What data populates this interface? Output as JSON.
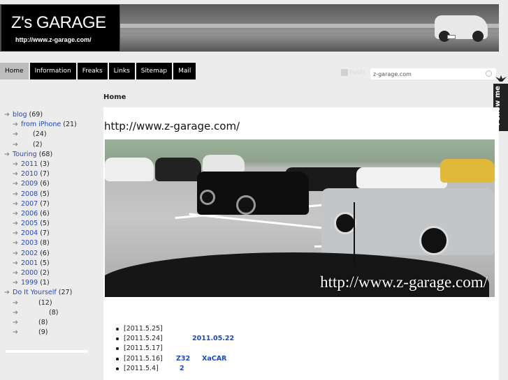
{
  "banner": {
    "title": "Z's GARAGE",
    "url": "http://www.z-garage.com/"
  },
  "nav": {
    "items": [
      "Home",
      "Information",
      "Freaks",
      "Links",
      "Sitemap",
      "Mail"
    ]
  },
  "search": {
    "rss_label": "Posts",
    "value": "z-garage.com"
  },
  "follow": {
    "label": "Follow me"
  },
  "breadcrumb": "Home",
  "main": {
    "site_url": "http://www.z-garage.com/",
    "hero_caption": "http://www.z-garage.com/"
  },
  "sidebar": {
    "blog": {
      "label": "blog",
      "count": "(69)"
    },
    "blog_children": [
      {
        "label": "from iPhone",
        "count": "(21)"
      },
      {
        "label": "",
        "count": "(24)"
      },
      {
        "label": "",
        "count": "(2)"
      }
    ],
    "touring": {
      "label": "Touring",
      "count": "(68)"
    },
    "touring_children": [
      {
        "label": "2011",
        "count": "(3)"
      },
      {
        "label": "2010",
        "count": "(7)"
      },
      {
        "label": "2009",
        "count": "(6)"
      },
      {
        "label": "2008",
        "count": "(5)"
      },
      {
        "label": "2007",
        "count": "(7)"
      },
      {
        "label": "2006",
        "count": "(6)"
      },
      {
        "label": "2005",
        "count": "(5)"
      },
      {
        "label": "2004",
        "count": "(7)"
      },
      {
        "label": "2003",
        "count": "(8)"
      },
      {
        "label": "2002",
        "count": "(6)"
      },
      {
        "label": "2001",
        "count": "(5)"
      },
      {
        "label": "2000",
        "count": "(2)"
      },
      {
        "label": "1999",
        "count": "(1)"
      }
    ],
    "diy": {
      "label": "Do It Yourself",
      "count": "(27)"
    },
    "diy_children": [
      {
        "label": "",
        "count": "(12)"
      },
      {
        "label": "",
        "count": "(8)"
      },
      {
        "label": "",
        "count": "(8)"
      },
      {
        "label": "",
        "count": "(9)"
      }
    ]
  },
  "news": [
    {
      "date": "[2011.5.25]",
      "link": ""
    },
    {
      "date": "[2011.5.24]",
      "link": "2011.05.22"
    },
    {
      "date": "[2011.5.17]",
      "link": ""
    },
    {
      "date": "[2011.5.16]",
      "link": "Z32",
      "link2": "XaCAR"
    },
    {
      "date": "[2011.5.4]",
      "link": "2"
    }
  ]
}
